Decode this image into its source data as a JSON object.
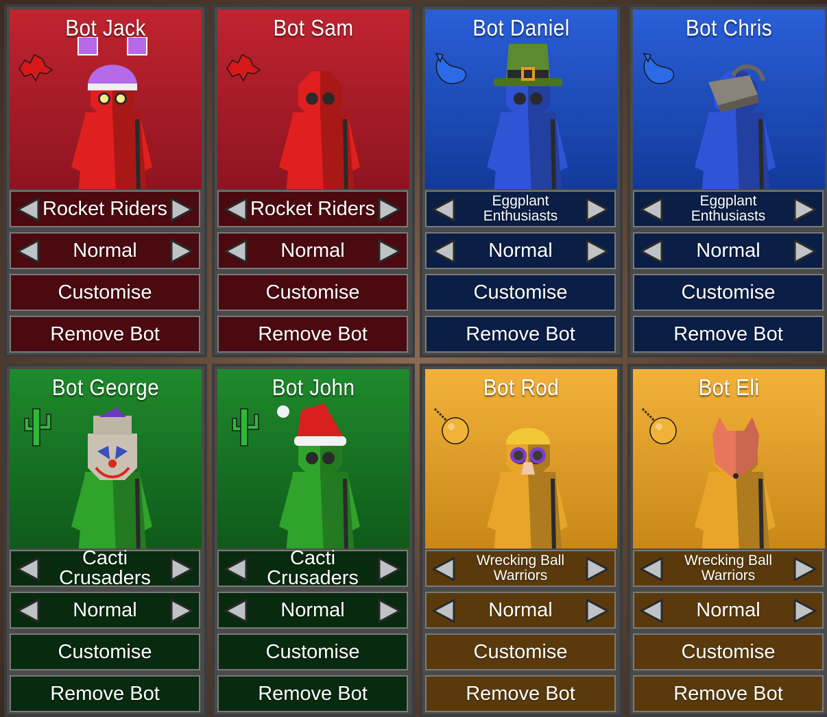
{
  "palette": {
    "red": {
      "bg1": "#c0242f",
      "bg2": "#8e1420",
      "btn": "#4a0a10",
      "body": "#e0201e",
      "icon": "#d81818"
    },
    "blue": {
      "bg1": "#2a5fd8",
      "bg2": "#123a9a",
      "btn": "#0a1e46",
      "body": "#2f55d6",
      "icon": "#2a6ce8"
    },
    "green": {
      "bg1": "#1f8a2c",
      "bg2": "#0f5a1a",
      "btn": "#082a0e",
      "body": "#2fa32b",
      "icon": "#2fb83a"
    },
    "yellow": {
      "bg1": "#f2b23a",
      "bg2": "#c98716",
      "btn": "#5a3a0c",
      "body": "#e8a52a",
      "icon": "#f2b23a"
    }
  },
  "arrows": {
    "prev_icon": "triangle-left-icon",
    "next_icon": "triangle-right-icon"
  },
  "bots": [
    {
      "name": "Bot Jack",
      "team": "Rocket Riders",
      "team_icon": "rocket-icon",
      "difficulty": "Normal",
      "customise": "Customise",
      "remove": "Remove Bot",
      "color": "red",
      "hat": "purple-helmet"
    },
    {
      "name": "Bot Sam",
      "team": "Rocket Riders",
      "team_icon": "rocket-icon",
      "difficulty": "Normal",
      "customise": "Customise",
      "remove": "Remove Bot",
      "color": "red",
      "hat": "none"
    },
    {
      "name": "Bot Daniel",
      "team": "Eggplant Enthusiasts",
      "team_icon": "eggplant-icon",
      "difficulty": "Normal",
      "customise": "Customise",
      "remove": "Remove Bot",
      "color": "blue",
      "hat": "green-top-hat"
    },
    {
      "name": "Bot Chris",
      "team": "Eggplant Enthusiasts",
      "team_icon": "eggplant-icon",
      "difficulty": "Normal",
      "customise": "Customise",
      "remove": "Remove Bot",
      "color": "blue",
      "hat": "vr-headset"
    },
    {
      "name": "Bot George",
      "team": "Cacti Crusaders",
      "team_icon": "cactus-icon",
      "difficulty": "Normal",
      "customise": "Customise",
      "remove": "Remove Bot",
      "color": "green",
      "hat": "clown-mask"
    },
    {
      "name": "Bot John",
      "team": "Cacti Crusaders",
      "team_icon": "cactus-icon",
      "difficulty": "Normal",
      "customise": "Customise",
      "remove": "Remove Bot",
      "color": "green",
      "hat": "santa-hat"
    },
    {
      "name": "Bot Rod",
      "team": "Wrecking Ball Warriors",
      "team_icon": "wrecking-ball-icon",
      "difficulty": "Normal",
      "customise": "Customise",
      "remove": "Remove Bot",
      "color": "yellow",
      "hat": "disguise-glasses"
    },
    {
      "name": "Bot Eli",
      "team": "Wrecking Ball Warriors",
      "team_icon": "wrecking-ball-icon",
      "difficulty": "Normal",
      "customise": "Customise",
      "remove": "Remove Bot",
      "color": "yellow",
      "hat": "fox-mask"
    }
  ]
}
